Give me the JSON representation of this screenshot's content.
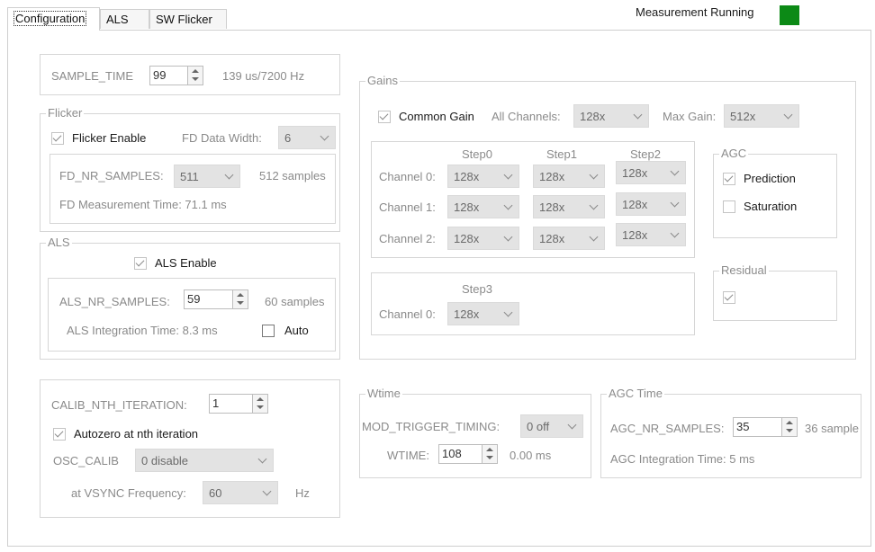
{
  "tabs": [
    "Configuration",
    "ALS",
    "SW Flicker"
  ],
  "status": {
    "text": "Measurement Running",
    "led_color": "#0c8a16"
  },
  "sample_time": {
    "label": "SAMPLE_TIME",
    "value": "99",
    "info": "139 us/7200 Hz"
  },
  "flicker": {
    "title": "Flicker",
    "enable_label": "Flicker Enable",
    "fd_width_label": "FD Data Width:",
    "fd_width_value": "6",
    "nr_samples_label": "FD_NR_SAMPLES:",
    "nr_samples_value": "511",
    "nr_samples_info": "512 samples",
    "measurement_time": "FD Measurement Time:  71.1 ms"
  },
  "als": {
    "title": "ALS",
    "enable_label": "ALS Enable",
    "nr_samples_label": "ALS_NR_SAMPLES:",
    "nr_samples_value": "59",
    "nr_samples_info": "60 samples",
    "integration_time": "ALS Integration Time:  8.3 ms",
    "auto_label": "Auto"
  },
  "calib": {
    "nth_label": "CALIB_NTH_ITERATION:",
    "nth_value": "1",
    "autozero_label": "Autozero at nth iteration",
    "osc_label": "OSC_CALIB",
    "osc_value": "0 disable",
    "vsync_label": "at VSYNC Frequency:",
    "vsync_value": "60",
    "vsync_unit": "Hz"
  },
  "gains": {
    "title": "Gains",
    "common_gain_label": "Common Gain",
    "all_channels_label": "All Channels:",
    "all_channels_value": "128x",
    "max_gain_label": "Max Gain:",
    "max_gain_value": "512x",
    "steps": [
      "Step0",
      "Step1",
      "Step2"
    ],
    "channels": [
      {
        "label": "Channel 0:",
        "values": [
          "128x",
          "128x",
          "128x"
        ]
      },
      {
        "label": "Channel 1:",
        "values": [
          "128x",
          "128x",
          "128x"
        ]
      },
      {
        "label": "Channel 2:",
        "values": [
          "128x",
          "128x",
          "128x"
        ]
      }
    ],
    "step3": {
      "label": "Step3",
      "channel_label": "Channel 0:",
      "value": "128x"
    },
    "agc": {
      "title": "AGC",
      "prediction_label": "Prediction",
      "saturation_label": "Saturation"
    },
    "residual": {
      "title": "Residual"
    }
  },
  "wtime": {
    "title": "Wtime",
    "mod_trigger_label": "MOD_TRIGGER_TIMING:",
    "mod_trigger_value": "0 off",
    "wtime_label": "WTIME:",
    "wtime_value": "108",
    "wtime_info": "0.00 ms"
  },
  "agc_time": {
    "title": "AGC Time",
    "nr_samples_label": "AGC_NR_SAMPLES:",
    "nr_samples_value": "35",
    "nr_samples_info": "36 sample",
    "integration_time": "AGC Integration Time:  5 ms"
  }
}
